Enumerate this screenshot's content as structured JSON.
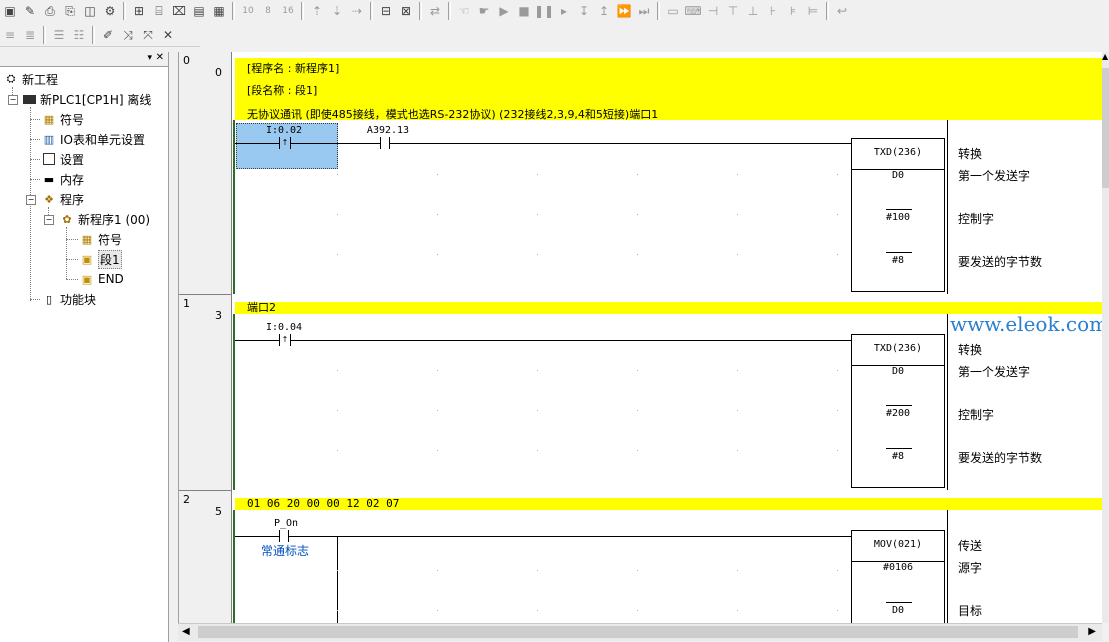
{
  "toolbar1": {
    "icons": [
      "new-icon",
      "edit-icon",
      "print-preview-icon",
      "print-icon",
      "split-icon",
      "properties-icon",
      "network-icon",
      "monitor-icon",
      "io-icon",
      "window-icon",
      "num-10-icon",
      "num-8-icon",
      "num-16-icon",
      "up-icon",
      "down-icon",
      "ladder-icon",
      "mnemonic-icon",
      "online-icon",
      "run-icon",
      "play-icon",
      "stop-icon",
      "pause-icon",
      "step-icon",
      "step-in-icon",
      "step-out-icon",
      "fast-forward-icon",
      "end-icon",
      "grid-icon",
      "keyboard-icon",
      "contact-icon",
      "coil-icon",
      "func-icon",
      "func2-icon",
      "func3-icon",
      "undo-icon"
    ],
    "labels": {
      "n10": "10",
      "n8": "8",
      "n16": "16"
    }
  },
  "toolbar2": {
    "icons": [
      "align-left-icon",
      "align-right-icon",
      "list-icon",
      "list2-icon",
      "pen-icon",
      "transfer-icon",
      "transfer2-icon",
      "cross-icon"
    ]
  },
  "tree": {
    "root": "新工程",
    "plc": "新PLC1[CP1H] 离线",
    "items": [
      "符号",
      "IO表和单元设置",
      "设置",
      "内存",
      "程序"
    ],
    "program": "新程序1 (00)",
    "program_items": [
      "符号",
      "段1",
      "END"
    ],
    "funcblock": "功能块"
  },
  "ladder": {
    "rungs": [
      {
        "index": "0",
        "step": "0",
        "header_lines": [
          "[程序名 : 新程序1]",
          "[段名称 : 段1]"
        ],
        "comment": "无协议通讯 (即使485接线，模式也选RS-232协议)  (232接线2,3,9,4和5短接)端口1",
        "contacts": [
          {
            "addr": "I:0.02"
          },
          {
            "addr": "A392.13"
          }
        ],
        "instr": {
          "name": "TXD(236)",
          "ops": [
            "D0",
            "#100",
            "#8"
          ],
          "comments": [
            "转换",
            "第一个发送字",
            "控制字",
            "要发送的字节数"
          ]
        }
      },
      {
        "index": "1",
        "step": "3",
        "comment": "端口2",
        "contacts": [
          {
            "addr": "I:0.04"
          }
        ],
        "instr": {
          "name": "TXD(236)",
          "ops": [
            "D0",
            "#200",
            "#8"
          ],
          "comments": [
            "转换",
            "第一个发送字",
            "控制字",
            "要发送的字节数"
          ]
        }
      },
      {
        "index": "2",
        "step": "5",
        "comment": "01 06 20 00 00 12 02 07",
        "contacts": [
          {
            "addr": "P_On",
            "note": "常通标志"
          }
        ],
        "instr": {
          "name": "MOV(021)",
          "ops": [
            "#0106",
            "D0"
          ],
          "comments": [
            "传送",
            "源字",
            "目标"
          ]
        }
      }
    ]
  },
  "watermark": "www.eleok.com",
  "colors": {
    "rung_comment": "#ffff00",
    "rail": "#2b6d2b",
    "selection": "#99c9f0",
    "note": "#0050c0"
  }
}
